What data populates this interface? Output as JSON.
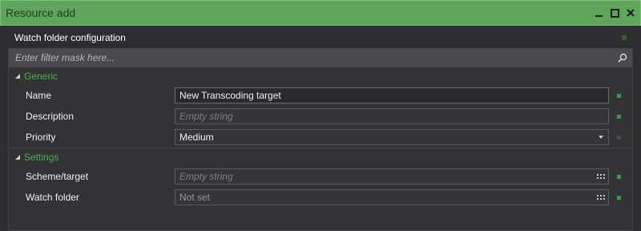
{
  "window": {
    "title": "Resource add"
  },
  "header": {
    "title": "Watch folder configuration"
  },
  "filter": {
    "placeholder": "Enter filter mask here..."
  },
  "sections": {
    "generic": {
      "label": "Generic",
      "name_label": "Name",
      "name_value": "New Transcoding target",
      "description_label": "Description",
      "description_placeholder": "Empty string",
      "priority_label": "Priority",
      "priority_value": "Medium"
    },
    "settings": {
      "label": "Settings",
      "scheme_label": "Scheme/target",
      "scheme_placeholder": "Empty string",
      "watch_label": "Watch folder",
      "watch_value": "Not set"
    }
  },
  "colors": {
    "titlebar": "#5fa65c",
    "accent": "#4caf50",
    "status_on": "#2ea043",
    "status_off": "#3d5a3d"
  },
  "icons": [
    "minimize-icon",
    "maximize-icon",
    "close-icon",
    "search-icon",
    "expand-triangle-icon",
    "ellipsis-grid-icon",
    "dropdown-arrow-icon"
  ]
}
